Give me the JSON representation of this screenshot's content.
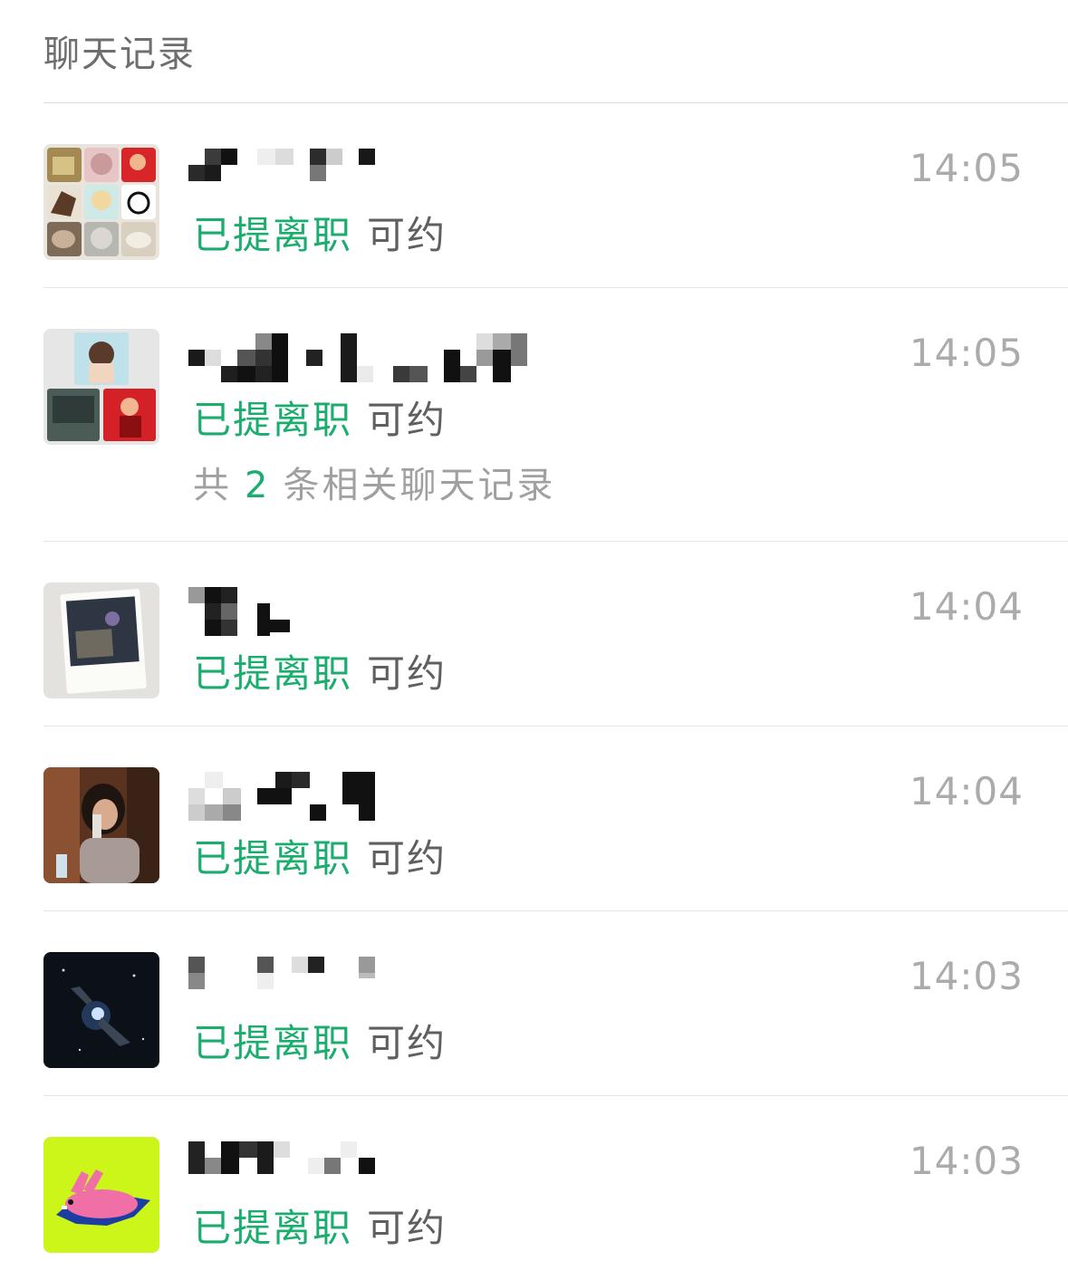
{
  "header": {
    "title": "聊天记录"
  },
  "results": [
    {
      "contact": "blurred-name",
      "avatar_icon": "collage-avatar-icon",
      "highlight": "已提离职",
      "rest": "可约",
      "time": "14:05"
    },
    {
      "contact": "blurred-name",
      "avatar_icon": "group-avatar-icon",
      "highlight": "已提离职",
      "rest": "可约",
      "time": "14:05",
      "related": {
        "prefix": "共",
        "count": "2",
        "suffix": "条相关聊天记录"
      }
    },
    {
      "contact": "blurred-name",
      "avatar_icon": "polaroid-avatar-icon",
      "highlight": "已提离职",
      "rest": "可约",
      "time": "14:04"
    },
    {
      "contact": "blurred-name",
      "avatar_icon": "photo-avatar-icon",
      "highlight": "已提离职",
      "rest": "可约",
      "time": "14:04"
    },
    {
      "contact": "blurred-name",
      "avatar_icon": "space-avatar-icon",
      "highlight": "已提离职",
      "rest": "可约",
      "time": "14:03"
    },
    {
      "contact": "blurred-name",
      "avatar_icon": "bunny-avatar-icon",
      "highlight": "已提离职",
      "rest": "可约",
      "time": "14:03"
    }
  ],
  "colors": {
    "highlight": "#1aad6d",
    "time": "#ababab",
    "header": "#6e6e6e",
    "divider": "#e4e4e4"
  }
}
